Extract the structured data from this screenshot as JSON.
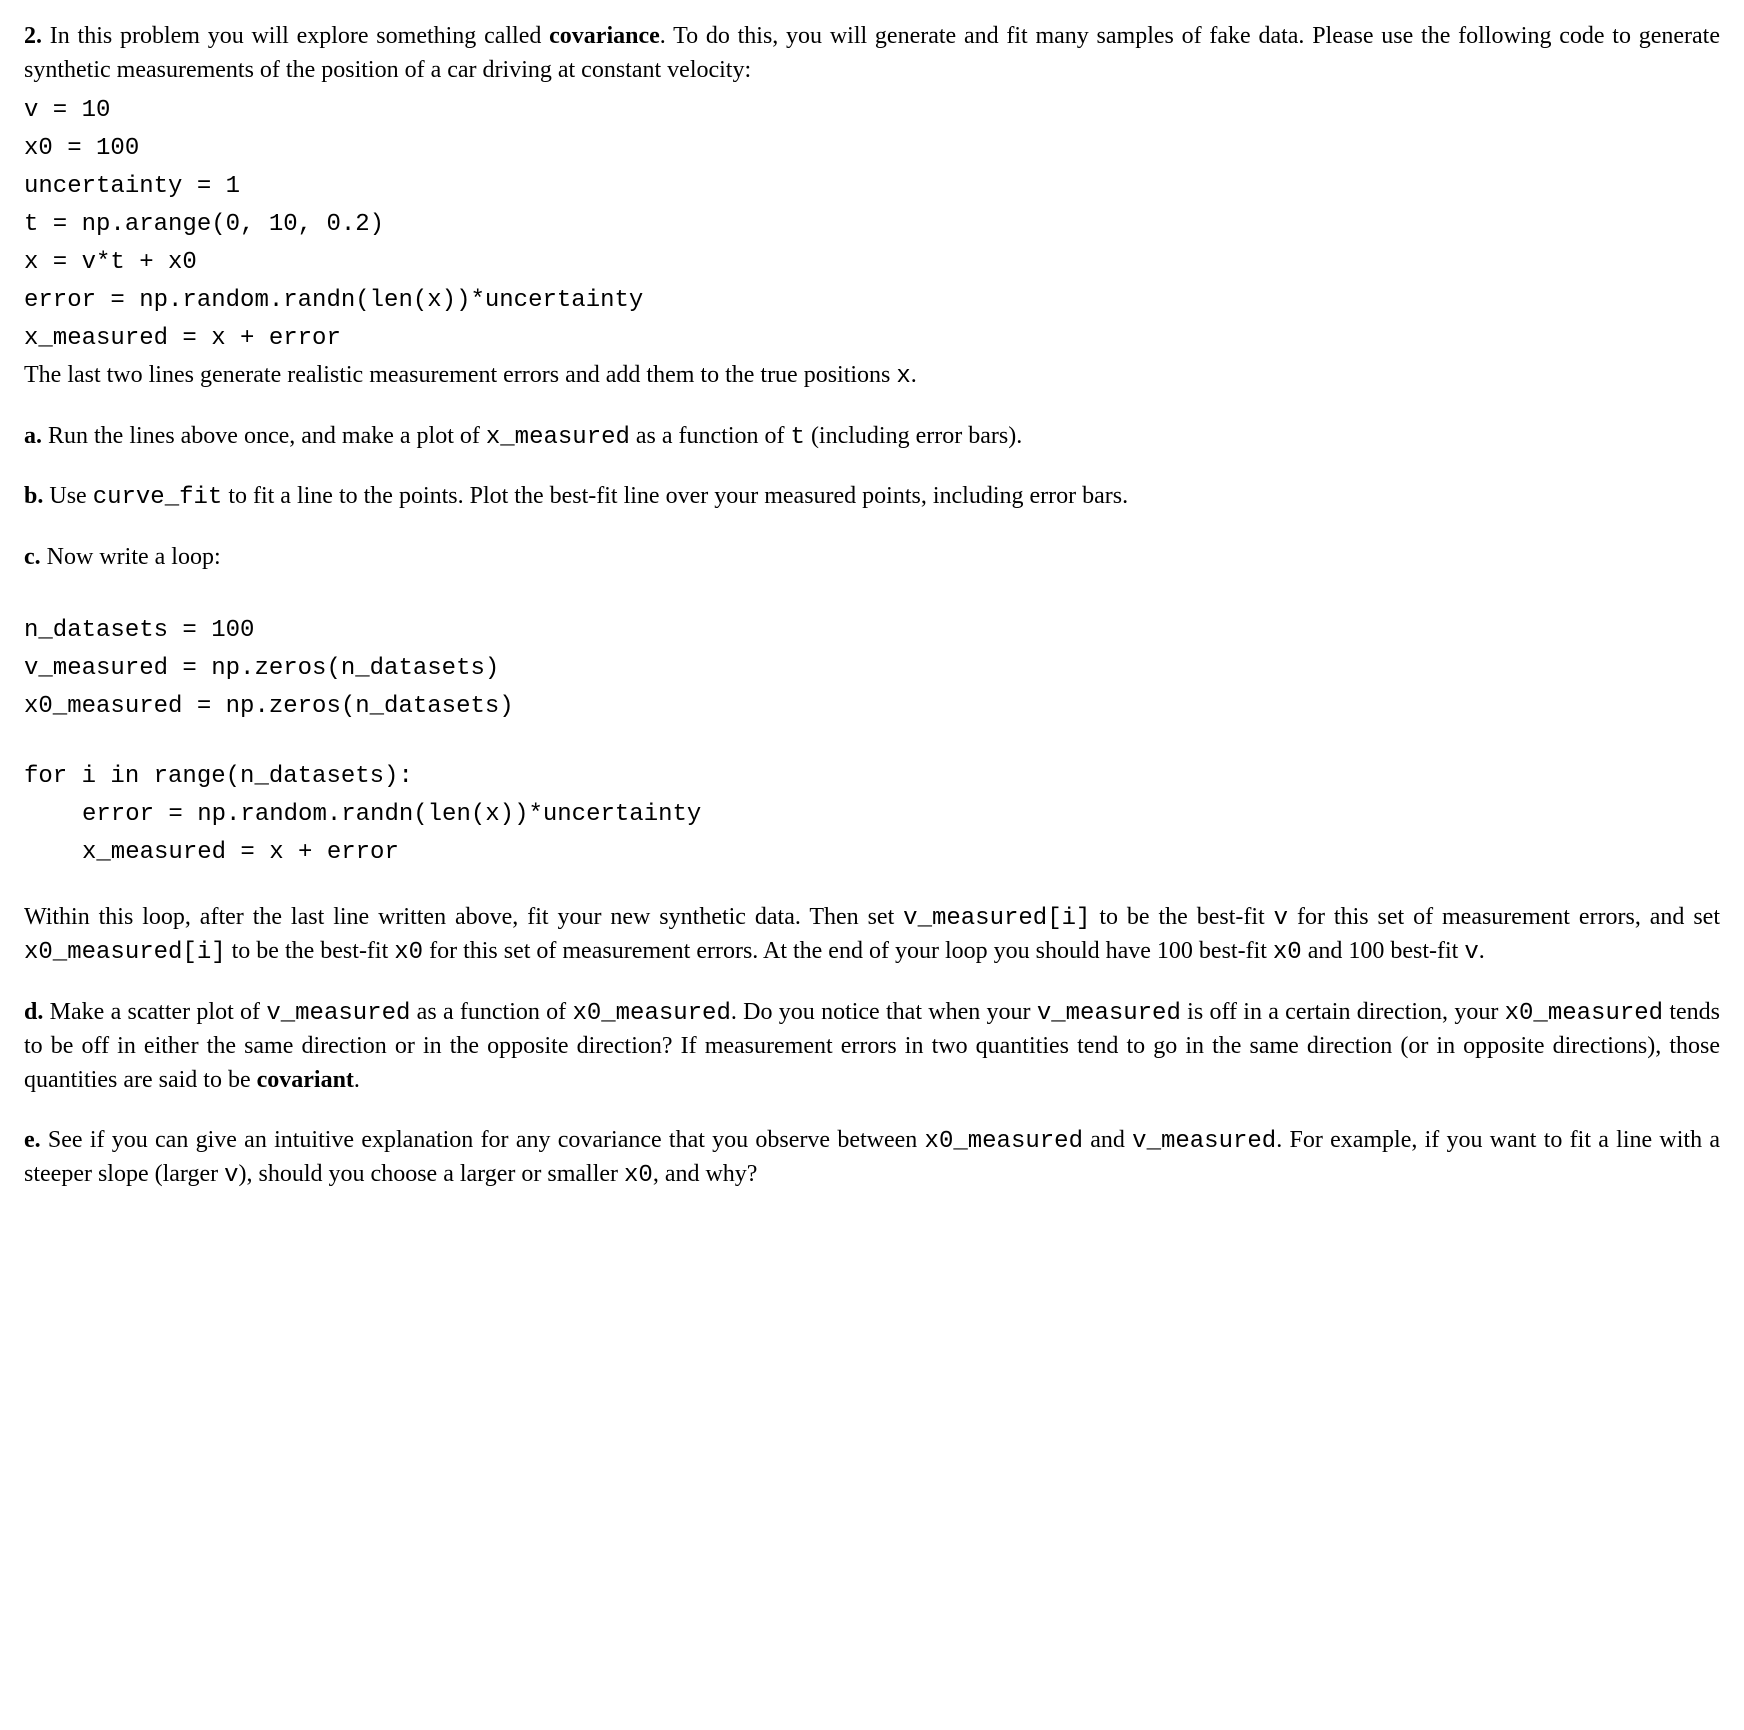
{
  "p1": {
    "num": "2.",
    "t1": " In this problem you will explore something called ",
    "bold1": "covariance",
    "t2": ". To do this, you will generate and fit many samples of fake data. Please use the following code to generate synthetic measurements of the position of a car driving at constant velocity:"
  },
  "code1": {
    "l1": "v = 10",
    "l2": "x0 = 100",
    "l3": "uncertainty = 1",
    "l4": "t = np.arange(0, 10, 0.2)",
    "l5": "x = v*t + x0",
    "l6": "error = np.random.randn(len(x))*uncertainty",
    "l7": "x_measured = x + error"
  },
  "p2": {
    "t1": "The last two lines generate realistic measurement errors and add them to the true positions ",
    "c1": "x",
    "t2": "."
  },
  "pa": {
    "num": "a.",
    "t1": " Run the lines above once, and make a plot of ",
    "c1": "x_measured",
    "t2": " as a function of ",
    "c2": "t",
    "t3": " (including error bars)."
  },
  "pb": {
    "num": "b.",
    "t1": " Use ",
    "c1": "curve_fit",
    "t2": " to fit a line to the points. Plot the best-fit line over your measured points, including error bars."
  },
  "pc": {
    "num": "c.",
    "t1": " Now write a loop:"
  },
  "code2": {
    "l1": "n_datasets = 100",
    "l2": "v_measured = np.zeros(n_datasets)",
    "l3": "x0_measured = np.zeros(n_datasets)",
    "l4": "for i in range(n_datasets):",
    "l5": "error = np.random.randn(len(x))*uncertainty",
    "l6": "x_measured = x + error"
  },
  "pc2": {
    "t1": "Within this loop, after the last line written above, fit your new synthetic data. Then set ",
    "c1": "v_measured[i]",
    "t2": " to be the best-fit ",
    "c2": "v",
    "t3": " for this set of measurement errors, and set ",
    "c3": "x0_measured[i]",
    "t4": " to be the best-fit ",
    "c4": "x0",
    "t5": " for this set of measurement errors. At the end of your loop you should have 100 best-fit ",
    "c5": "x0",
    "t6": " and 100 best-fit ",
    "c6": "v",
    "t7": "."
  },
  "pd": {
    "num": "d.",
    "t1": "  Make a scatter plot of ",
    "c1": "v_measured",
    "t2": " as a function of ",
    "c2": "x0_measured",
    "t3": ".  Do you notice that when your ",
    "c3": "v_measured",
    "t4": " is off in a certain direction, your ",
    "c4": "x0_measured",
    "t5": " tends to be off in either the same direction or in the opposite direction? If measurement errors in two quantities tend to go in the same direction (or in opposite directions), those quantities are said to be ",
    "bold1": "covariant",
    "t6": "."
  },
  "pe": {
    "num": "e.",
    "t1": " See if you can give an intuitive explanation for any covariance that you observe between ",
    "c1": "x0_measured",
    "t2": " and ",
    "c2": "v_measured",
    "t3": ". For example, if you want to fit a line with a steeper slope (larger ",
    "c3": "v",
    "t4": "), should you choose a larger or smaller ",
    "c4": "x0",
    "t5": ", and why?"
  }
}
